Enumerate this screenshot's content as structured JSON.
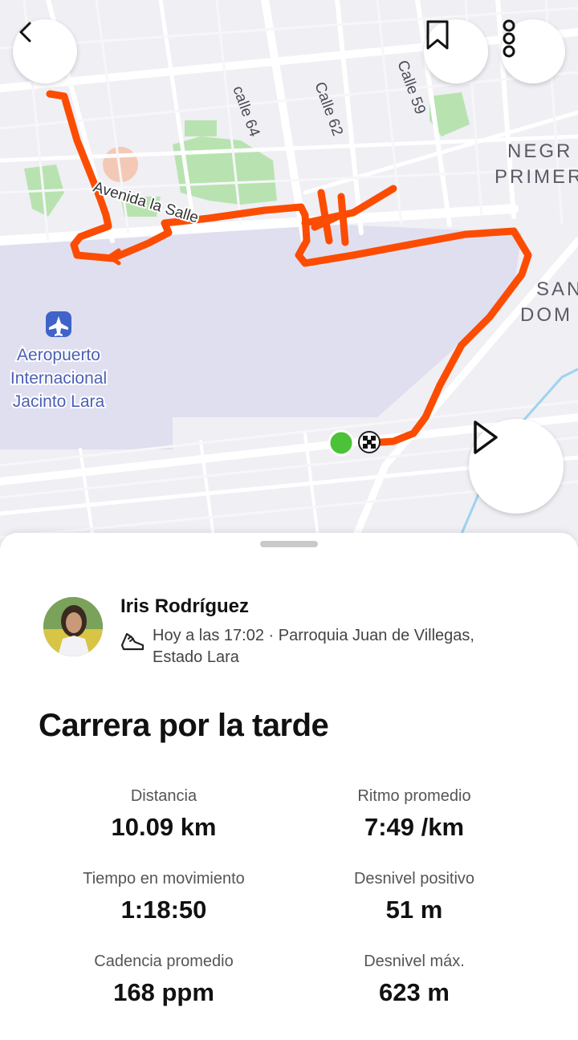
{
  "map": {
    "street_labels": [
      "calle 64",
      "Calle 62",
      "Calle 59",
      "Avenida la Salle"
    ],
    "area_labels": [
      "NEGR",
      "PRIMER",
      "SAN",
      "DOM"
    ],
    "airport_label_lines": [
      "Aeropuerto",
      "Internacional",
      "Jacinto Lara"
    ],
    "route_color": "#fc4c02",
    "start_marker_color": "#4bc238"
  },
  "toolbar": {
    "back_icon": "chevron-left-icon",
    "bookmark_icon": "bookmark-icon",
    "more_icon": "more-vertical-icon",
    "play_icon": "play-icon"
  },
  "activity": {
    "athlete_name": "Iris Rodríguez",
    "meta": "Hoy a las 17:02 · Parroquia Juan de Villegas, Estado Lara",
    "type_icon": "running-shoe-icon",
    "title": "Carrera por la tarde"
  },
  "stats": [
    {
      "label": "Distancia",
      "value": "10.09 km"
    },
    {
      "label": "Ritmo promedio",
      "value": "7:49 /km"
    },
    {
      "label": "Tiempo en movimiento",
      "value": "1:18:50"
    },
    {
      "label": "Desnivel positivo",
      "value": "51 m"
    },
    {
      "label": "Cadencia promedio",
      "value": "168 ppm"
    },
    {
      "label": "Desnivel máx.",
      "value": "623 m"
    }
  ]
}
